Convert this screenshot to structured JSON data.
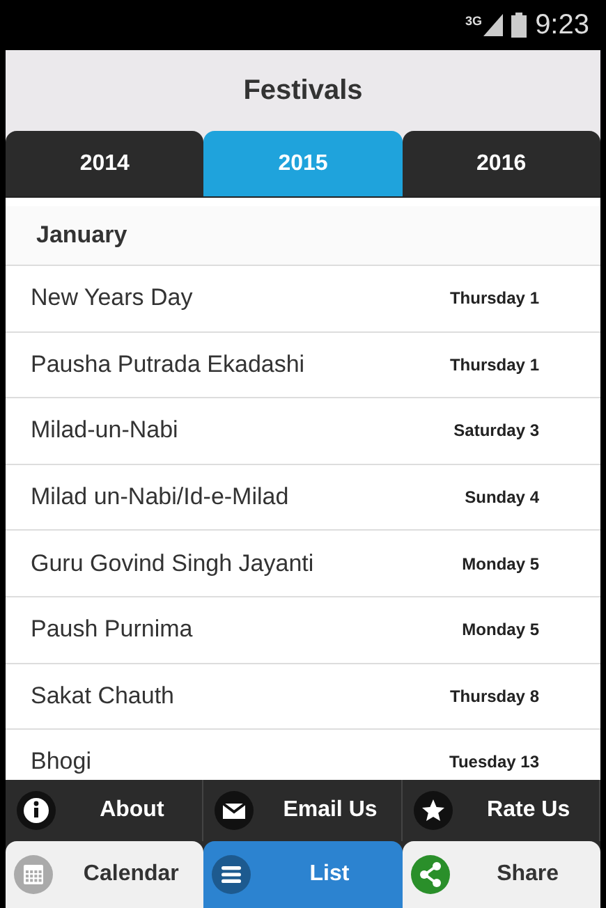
{
  "status_bar": {
    "network": "3G",
    "time": "9:23"
  },
  "title": "Festivals",
  "tabs": [
    {
      "label": "2014",
      "selected": false
    },
    {
      "label": "2015",
      "selected": true
    },
    {
      "label": "2016",
      "selected": false
    }
  ],
  "month": "January",
  "festivals": [
    {
      "name": "New Years Day",
      "date": "Thursday 1"
    },
    {
      "name": "Pausha Putrada Ekadashi",
      "date": "Thursday 1"
    },
    {
      "name": "Milad-un-Nabi",
      "date": "Saturday 3"
    },
    {
      "name": "Milad un-Nabi/Id-e-Milad",
      "date": "Sunday 4"
    },
    {
      "name": "Guru Govind Singh Jayanti",
      "date": "Monday 5"
    },
    {
      "name": "Paush Purnima",
      "date": "Monday 5"
    },
    {
      "name": "Sakat Chauth",
      "date": "Thursday 8"
    },
    {
      "name": "Bhogi",
      "date": "Tuesday 13"
    }
  ],
  "actions": [
    {
      "label": "About",
      "kind": "info"
    },
    {
      "label": "Email Us",
      "kind": "mail"
    },
    {
      "label": "Rate Us",
      "kind": "star"
    }
  ],
  "nav": [
    {
      "label": "Calendar",
      "kind": "calendar",
      "selected": false
    },
    {
      "label": "List",
      "kind": "list",
      "selected": true
    },
    {
      "label": "Share",
      "kind": "share",
      "selected": false
    }
  ]
}
